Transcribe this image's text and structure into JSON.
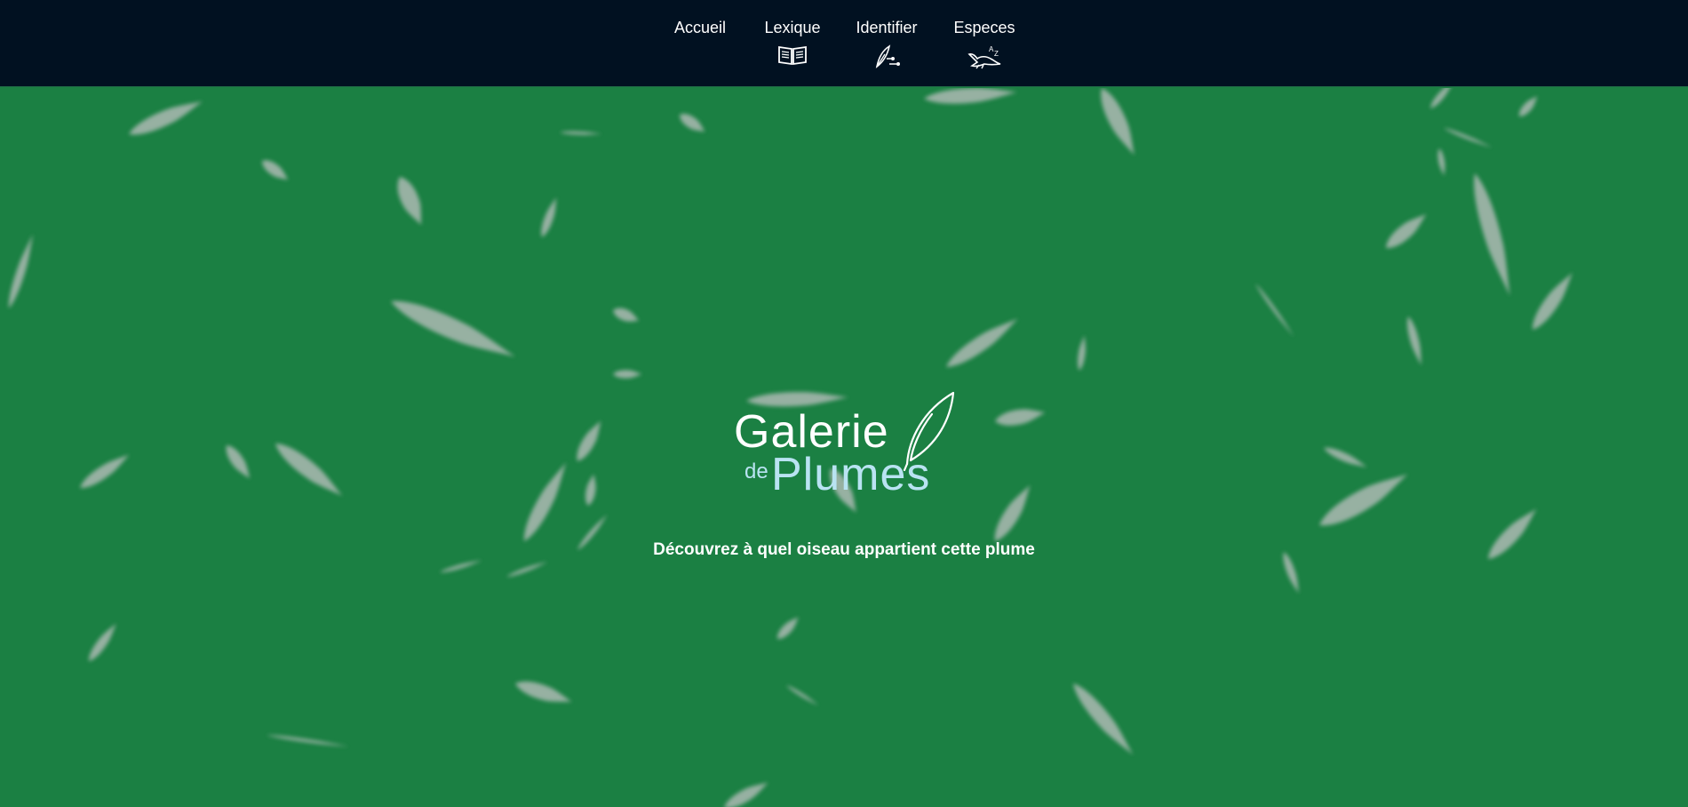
{
  "nav": {
    "items": [
      {
        "label": "Accueil",
        "icon": ""
      },
      {
        "label": "Lexique",
        "icon": "book-icon"
      },
      {
        "label": "Identifier",
        "icon": "feather-identify-icon"
      },
      {
        "label": "Especes",
        "icon": "bird-az-icon"
      }
    ]
  },
  "hero": {
    "logo": {
      "main": "Galerie",
      "de": "de",
      "sub": "Plumes",
      "icon": "feather-logo-icon"
    },
    "tagline": "Découvrez à quel oiseau appartient cette plume",
    "background": "falling-feathers",
    "colors": {
      "background": "#1b8043",
      "nav": "#011121",
      "accent": "#b9e3f2",
      "feather": "#a9b8b0"
    }
  }
}
